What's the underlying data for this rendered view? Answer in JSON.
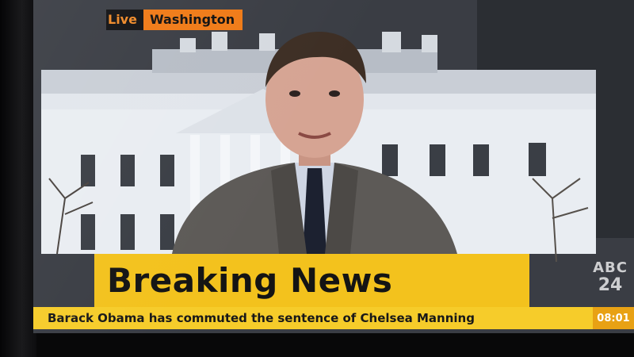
{
  "broadcast": {
    "live_label": "Live",
    "location": "Washington",
    "headline": "Breaking News",
    "ticker": "Barack Obama has commuted the sentence of Chelsea Manning",
    "clock": "08:01",
    "channel_logo_mark": "ABC",
    "channel_logo_number": "24"
  },
  "colors": {
    "accent_orange": "#f07a16",
    "headline_yellow": "#f3c21d",
    "ticker_yellow": "#f6cc2a",
    "building_white": "#e9edf2"
  },
  "icons": [
    "abc-news-24-logo"
  ]
}
